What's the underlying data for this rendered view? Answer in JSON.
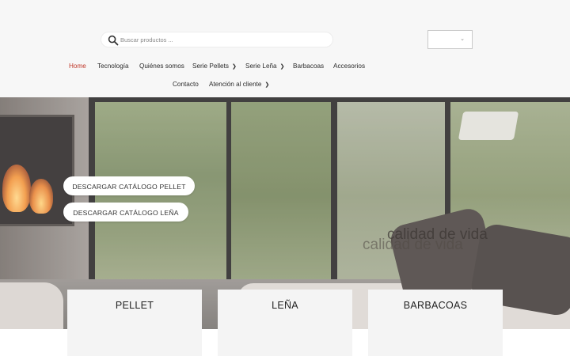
{
  "search": {
    "placeholder": "Buscar productos ...",
    "icon": "search-icon"
  },
  "language_selector": {
    "value": "",
    "icon": "chevron-down-icon"
  },
  "nav": {
    "items": [
      {
        "label": "Home",
        "active": true
      },
      {
        "label": "Tecnología"
      },
      {
        "label": "Quiénes somos"
      },
      {
        "label": "Serie Pellets",
        "has_dropdown": true
      },
      {
        "label": "Serie Leña",
        "has_dropdown": true
      },
      {
        "label": "Barbacoas"
      },
      {
        "label": "Accesorios"
      },
      {
        "label": "Contacto"
      },
      {
        "label": "Atención al cliente",
        "has_dropdown": true
      }
    ]
  },
  "hero": {
    "buttons": {
      "pellet": "DESCARGAR CATÁLOGO PELLET",
      "lena": "DESCARGAR CATÁLOGO LEÑA"
    },
    "tagline": "calidad de vida"
  },
  "categories": [
    {
      "title": "PELLET"
    },
    {
      "title": "LEÑA"
    },
    {
      "title": "BARBACOAS"
    }
  ],
  "colors": {
    "active_nav": "#c0392b",
    "background": "#f7f7f7",
    "card": "#f4f4f4"
  }
}
